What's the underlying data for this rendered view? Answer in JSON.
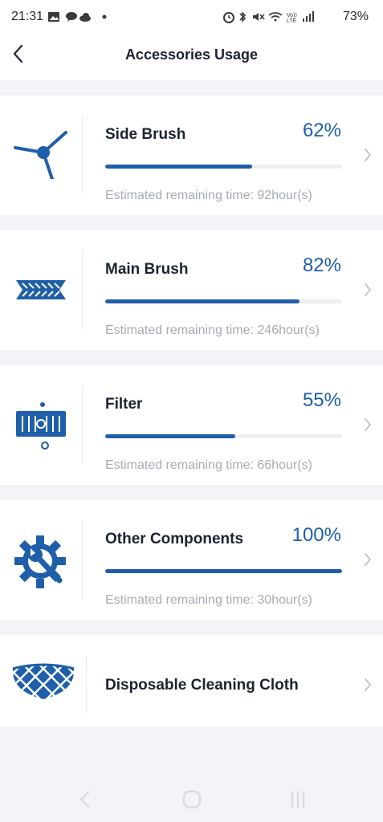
{
  "status_bar": {
    "time": "21:31",
    "battery": "73%",
    "left_icons": [
      "gallery-icon",
      "chat-icon",
      "cloud-icon",
      "dot-icon"
    ],
    "right_icons": [
      "alarm-icon",
      "bluetooth-icon",
      "mute-icon",
      "wifi-icon",
      "volte-icon",
      "signal-icon"
    ]
  },
  "header": {
    "title": "Accessories Usage",
    "back_icon": "chevron-left-icon"
  },
  "accessories": [
    {
      "name": "Side Brush",
      "percent": "62%",
      "level": 0.62,
      "remaining": "Estimated remaining time: 92hour(s)",
      "icon": "side-brush-icon"
    },
    {
      "name": "Main Brush",
      "percent": "82%",
      "level": 0.82,
      "remaining": "Estimated remaining time: 246hour(s)",
      "icon": "main-brush-icon"
    },
    {
      "name": "Filter",
      "percent": "55%",
      "level": 0.55,
      "remaining": "Estimated remaining time: 66hour(s)",
      "icon": "filter-icon"
    },
    {
      "name": "Other Components",
      "percent": "100%",
      "level": 1.0,
      "remaining": "Estimated remaining time: 30hour(s)",
      "icon": "gear-wrench-icon"
    },
    {
      "name": "Disposable Cleaning Cloth",
      "icon": "cleaning-cloth-icon"
    }
  ],
  "colors": {
    "accent": "#1f5faa",
    "track": "#eceef2",
    "background": "#f3f4f8",
    "muted_text": "#a6abb3"
  },
  "nav_bar": {
    "icons": [
      "nav-back-icon",
      "nav-home-icon",
      "nav-recents-icon"
    ]
  }
}
